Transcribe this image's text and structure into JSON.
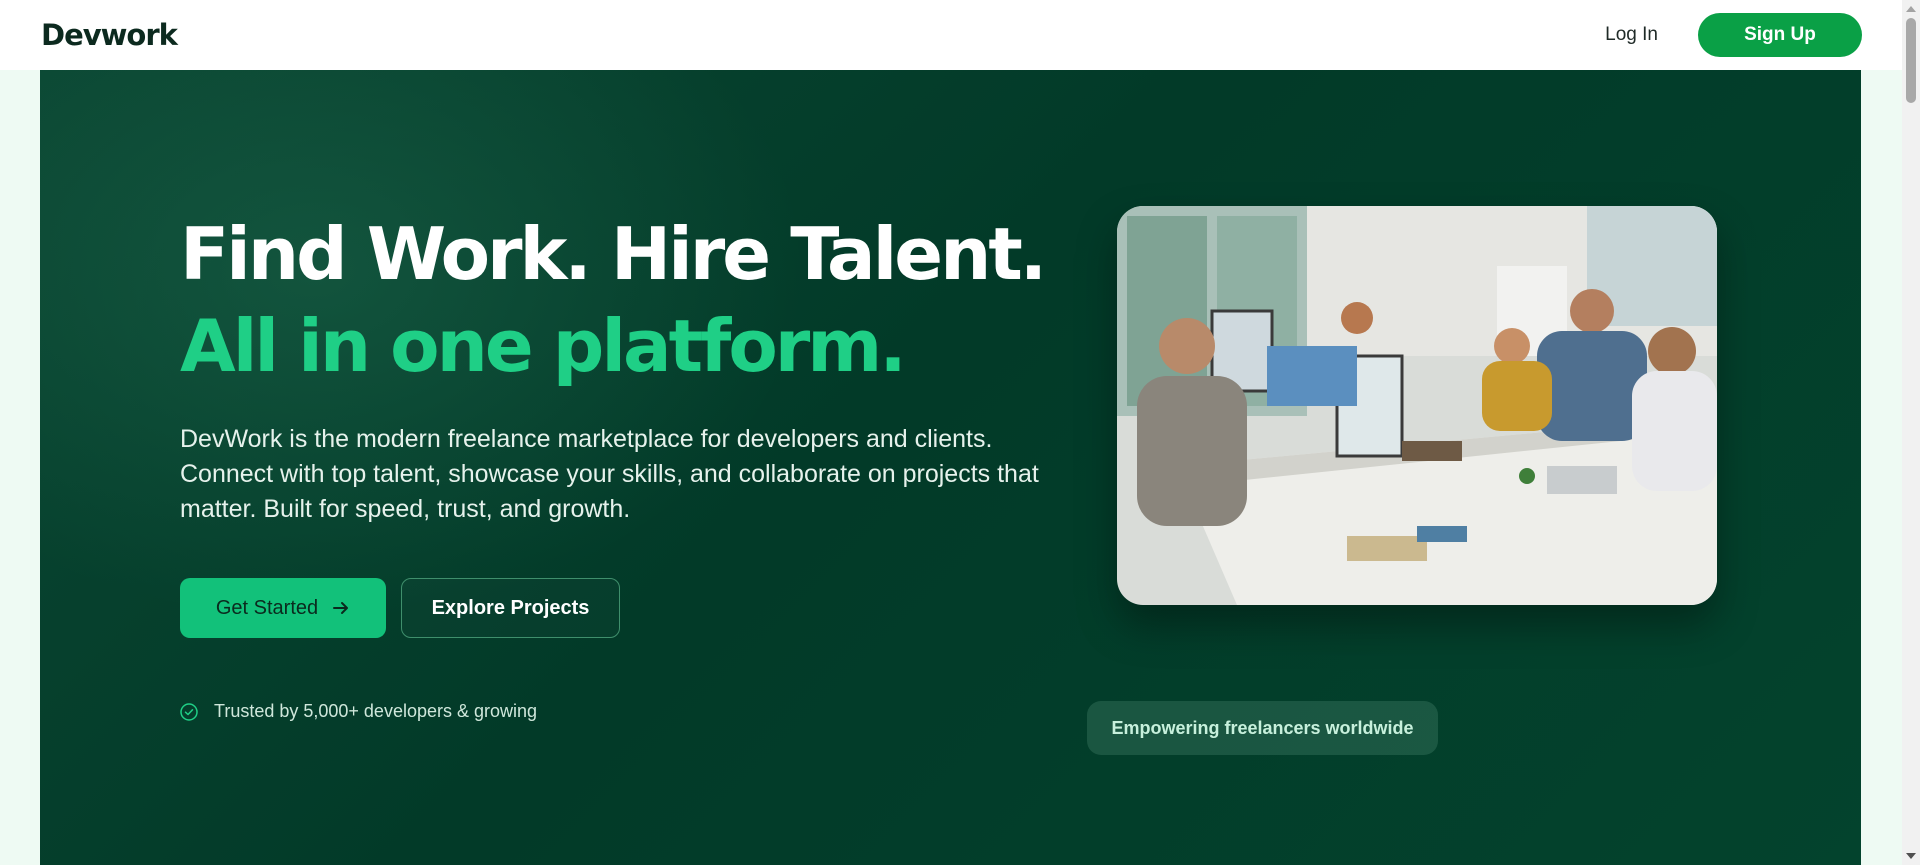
{
  "header": {
    "logo": "Devwork",
    "login_label": "Log In",
    "signup_label": "Sign Up"
  },
  "hero": {
    "title_line1": "Find Work. Hire Talent.",
    "title_line2": "All in one platform.",
    "description": "DevWork is the modern freelance marketplace for developers and clients. Connect with top talent, showcase your skills, and collaborate on projects that matter. Built for speed, trust, and growth.",
    "primary_button": "Get Started",
    "secondary_button": "Explore Projects",
    "trusted_text": "Trusted by 5,000+ developers & growing",
    "badge_text": "Empowering freelancers worldwide"
  },
  "icons": {
    "arrow": "arrow-right-icon",
    "check": "check-circle-icon"
  },
  "colors": {
    "brand_green": "#0aa046",
    "accent_green": "#1fcf86",
    "hero_bg": "#023a28"
  }
}
